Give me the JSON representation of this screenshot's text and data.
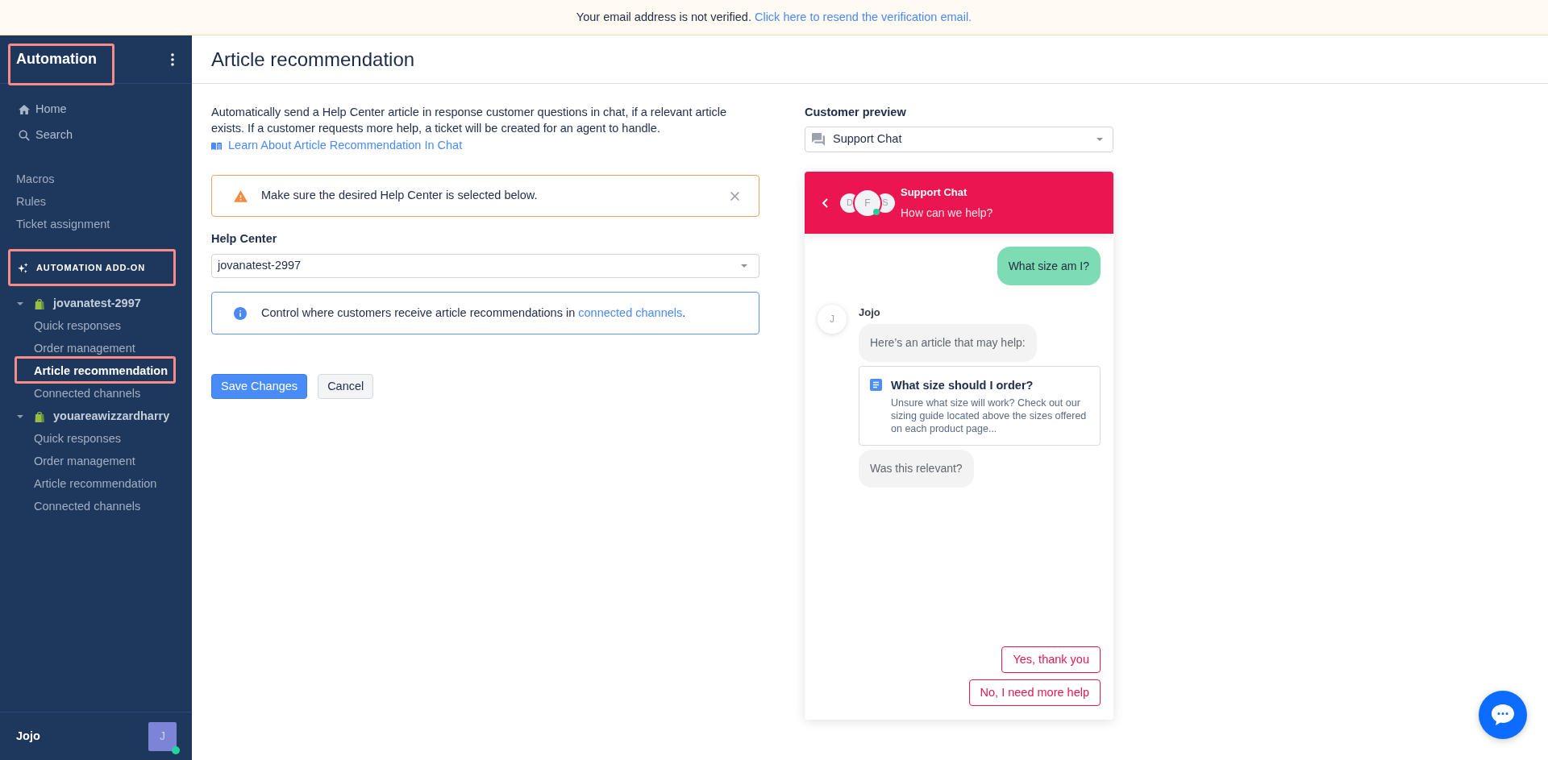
{
  "banner": {
    "text": "Your email address is not verified.",
    "link": "Click here to resend the verification email."
  },
  "sidebar": {
    "title": {
      "text": "Automation",
      "highlighted": true
    },
    "nav": [
      {
        "kind": "home",
        "label": "Home"
      },
      {
        "kind": "search",
        "label": "Search"
      }
    ],
    "links": [
      "Macros",
      "Rules",
      "Ticket assignment"
    ],
    "section": {
      "label": "AUTOMATION ADD-ON",
      "highlighted": true
    },
    "stores": [
      {
        "name": "jovanatest-2997",
        "expanded": true,
        "items": [
          {
            "label": "Quick responses",
            "selected": false,
            "highlighted": false
          },
          {
            "label": "Order management",
            "selected": false,
            "highlighted": false
          },
          {
            "label": "Article recommendation",
            "selected": true,
            "highlighted": true
          },
          {
            "label": "Connected channels",
            "selected": false,
            "highlighted": false
          }
        ]
      },
      {
        "name": "youareawizzardharry",
        "expanded": true,
        "items": [
          {
            "label": "Quick responses",
            "selected": false,
            "highlighted": false
          },
          {
            "label": "Order management",
            "selected": false,
            "highlighted": false
          },
          {
            "label": "Article recommendation",
            "selected": false,
            "highlighted": false
          },
          {
            "label": "Connected channels",
            "selected": false,
            "highlighted": false
          }
        ]
      }
    ],
    "user": {
      "name": "Jojo",
      "initial": "J",
      "online": true
    }
  },
  "page": {
    "title": "Article recommendation"
  },
  "settings": {
    "description": "Automatically send a Help Center article in response customer questions in chat, if a relevant article exists. If a customer requests more help, a ticket will be created for an agent to handle.",
    "learn_link": "Learn About Article Recommendation In Chat",
    "warning": "Make sure the desired Help Center is selected below.",
    "help_center": {
      "label": "Help Center",
      "value": "jovanatest-2997"
    },
    "info": {
      "text": "Control where customers receive article recommendations in",
      "link": "connected channels",
      "after": "."
    },
    "buttons": [
      {
        "kind": "primary",
        "label": "Save Changes"
      },
      {
        "kind": "secondary",
        "label": "Cancel"
      }
    ]
  },
  "preview": {
    "label": "Customer preview",
    "channel": "Support Chat",
    "chat": {
      "title": "Support Chat",
      "subtitle": "How can we help?",
      "agents": [
        {
          "initial": "D",
          "online": false
        },
        {
          "initial": "F",
          "online": true
        },
        {
          "initial": "S",
          "online": false
        }
      ],
      "messages": [
        {
          "kind": "customer",
          "text": "What size am I?"
        },
        {
          "kind": "agent",
          "author": "Jojo",
          "initial": "J",
          "items": [
            {
              "kind": "bubble",
              "text": "Here’s an article that may help:"
            },
            {
              "kind": "article",
              "title": "What size should I order?",
              "summary": "Unsure what size will work? Check out our sizing guide located above the sizes offered on each product page..."
            },
            {
              "kind": "bubble",
              "text": "Was this relevant?"
            }
          ]
        }
      ],
      "replies": [
        "Yes, thank you",
        "No, I need more help"
      ]
    }
  }
}
